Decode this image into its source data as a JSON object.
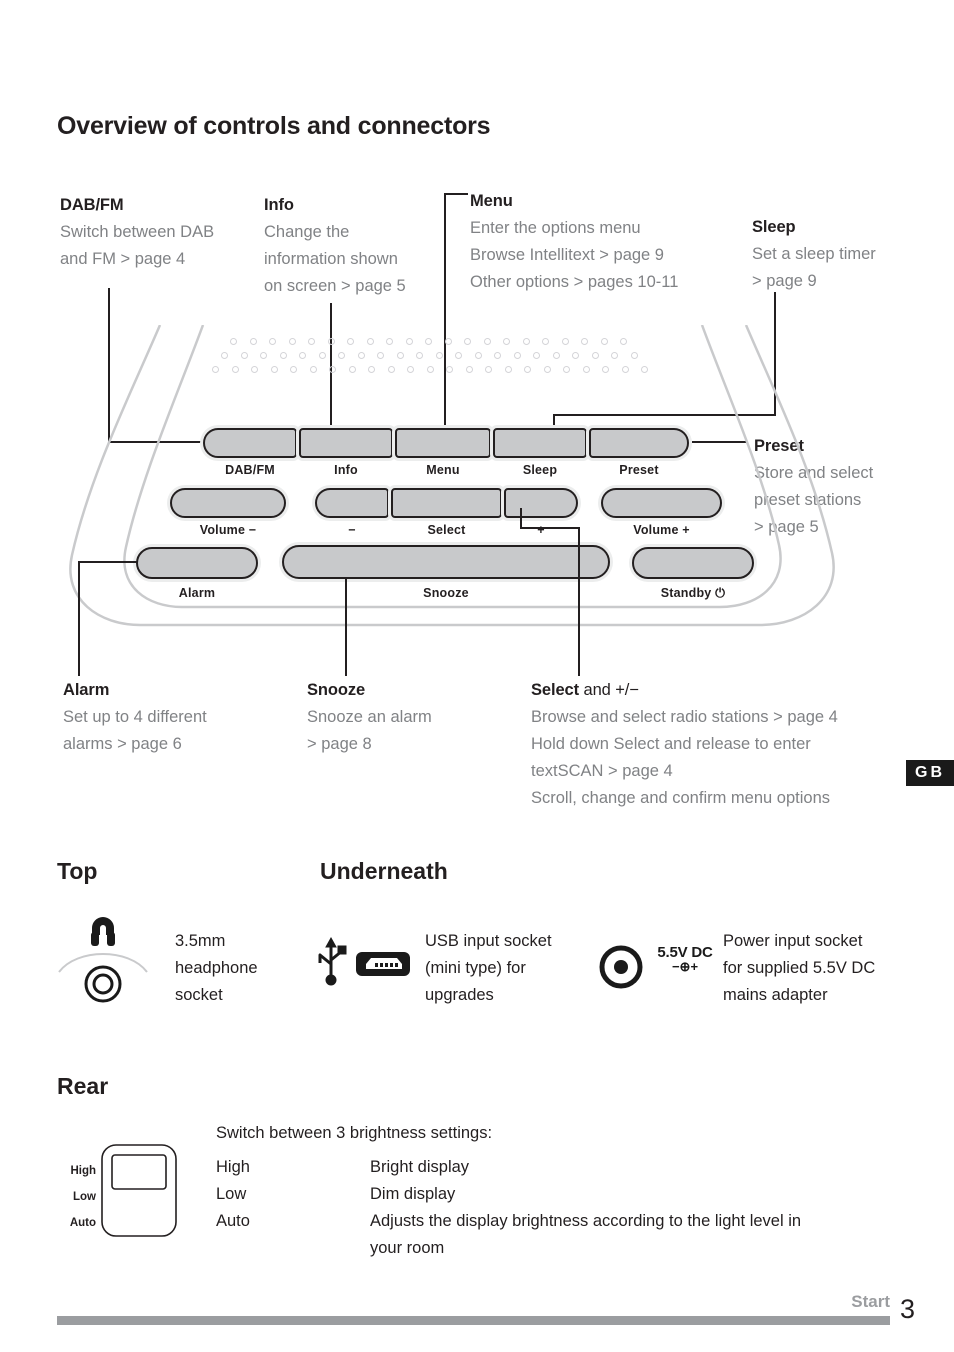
{
  "page": {
    "title": "Overview of controls and connectors",
    "locale_badge": "GB",
    "footer_label": "Start",
    "footer_page_number": "3"
  },
  "callouts": {
    "dabfm": {
      "heading": "DAB/FM",
      "lines": [
        "Switch between DAB",
        "and FM > page 4"
      ]
    },
    "info": {
      "heading": "Info",
      "lines": [
        "Change the",
        "information shown",
        "on screen > page 5"
      ]
    },
    "menu": {
      "heading": "Menu",
      "lines": [
        "Enter the options menu",
        "Browse Intellitext > page 9",
        "Other options > pages 10-11"
      ]
    },
    "sleep": {
      "heading": "Sleep",
      "lines": [
        "Set a sleep timer",
        "> page 9"
      ]
    },
    "preset": {
      "heading": "Preset",
      "lines": [
        "Store and select",
        "preset stations",
        "> page 5"
      ]
    },
    "alarm": {
      "heading": "Alarm",
      "lines": [
        "Set up to 4 different",
        "alarms > page 6"
      ]
    },
    "snooze": {
      "heading": "Snooze",
      "lines": [
        "Snooze an alarm",
        "> page 8"
      ]
    },
    "select": {
      "heading_bold": "Select",
      "heading_rest": " and +/−",
      "lines": [
        "Browse and select radio stations > page 4",
        "Hold down Select and release to enter",
        "textSCAN > page 4",
        "Scroll, change and confirm menu options"
      ]
    }
  },
  "radio": {
    "button_labels_row1": [
      "DAB/FM",
      "Info",
      "Menu",
      "Sleep",
      "Preset"
    ],
    "button_labels_row2": [
      "Volume −",
      "−",
      "Select",
      "+",
      "Volume +"
    ],
    "button_labels_row3": [
      "Alarm",
      "Snooze",
      "Standby ⏻"
    ]
  },
  "sections": {
    "top": {
      "title": "Top",
      "items": [
        {
          "icon": "headphone-socket-icon",
          "lines": [
            "3.5mm",
            "headphone",
            "socket"
          ]
        }
      ]
    },
    "underneath": {
      "title": "Underneath",
      "items": [
        {
          "icon": "usb-mini-socket-icon",
          "lines": [
            "USB input socket",
            "(mini type) for",
            "upgrades"
          ]
        },
        {
          "icon": "dc-power-socket-icon",
          "icon_label": "5.5V DC",
          "icon_polarity": "−⊕+",
          "lines": [
            "Power input socket",
            "for supplied 5.5V DC",
            "mains adapter"
          ]
        }
      ]
    },
    "rear": {
      "title": "Rear",
      "intro": "Switch between 3 brightness settings:",
      "switch_labels": [
        "High",
        "Low",
        "Auto"
      ],
      "rows": [
        {
          "setting": "High",
          "description": "Bright display"
        },
        {
          "setting": "Low",
          "description": "Dim display"
        },
        {
          "setting": "Auto",
          "description": "Adjusts the display brightness according to the light level in"
        }
      ],
      "continuation": "your room"
    }
  },
  "colors": {
    "ink": "#231f20",
    "muted": "#808285",
    "button_fill": "#c8c9cb",
    "body_outline": "#c9cacc",
    "footer_rule": "#9b9da0"
  }
}
